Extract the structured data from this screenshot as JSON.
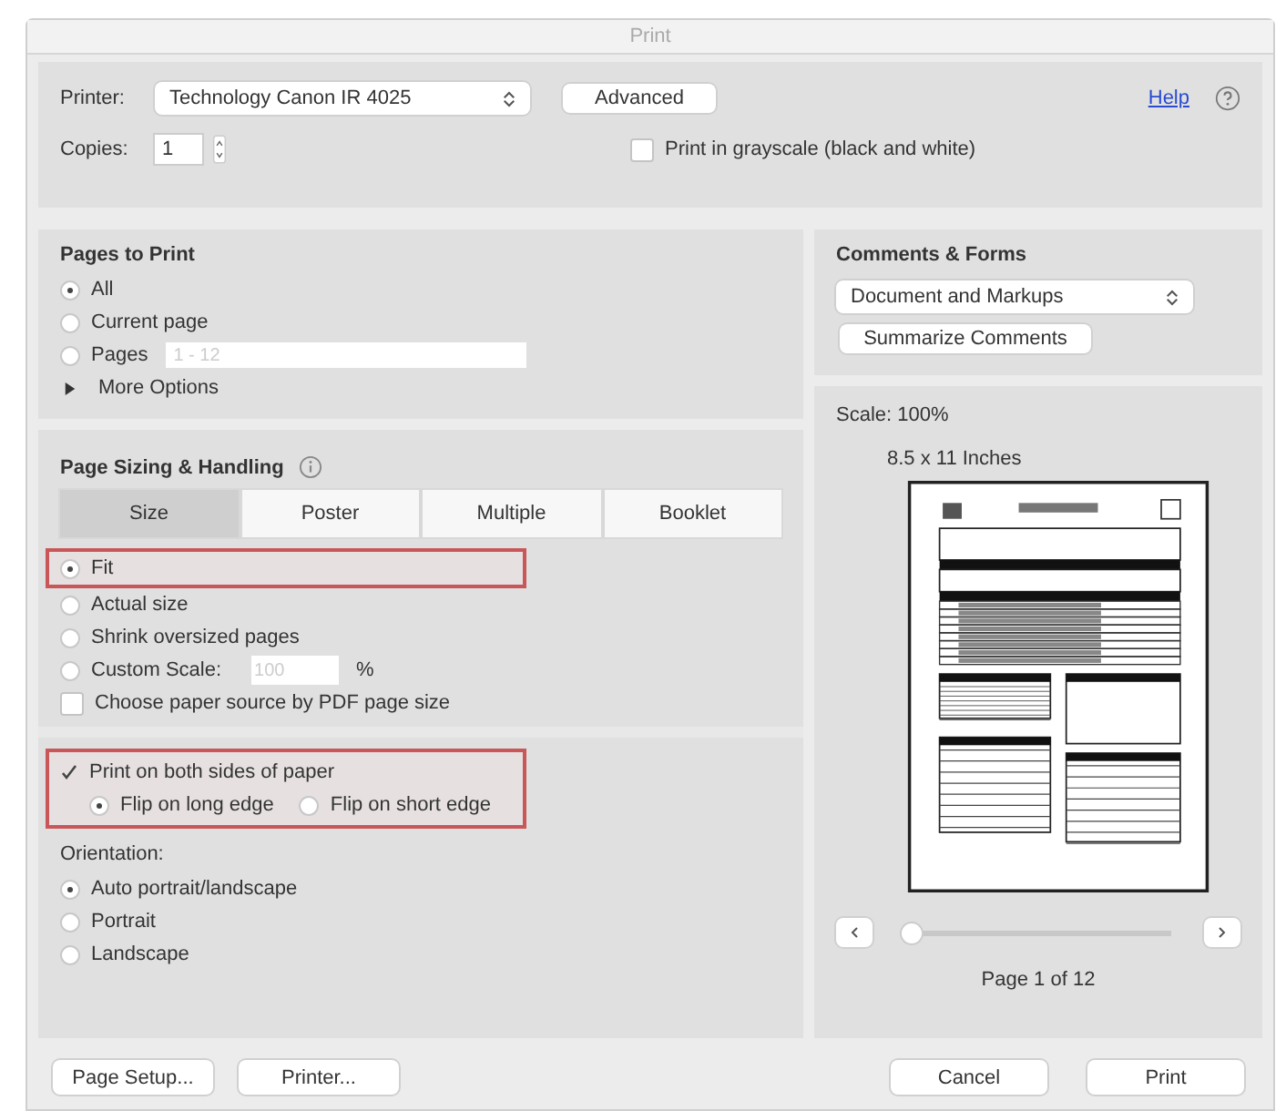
{
  "window": {
    "title": "Print"
  },
  "printer": {
    "label": "Printer:",
    "value": "Technology Canon IR 4025",
    "advanced": "Advanced"
  },
  "help": "Help",
  "copies": {
    "label": "Copies:",
    "value": "1"
  },
  "grayscale": {
    "label": "Print in grayscale (black and white)",
    "checked": false
  },
  "pages_to_print": {
    "title": "Pages to Print",
    "options": [
      {
        "label": "All",
        "selected": true
      },
      {
        "label": "Current page",
        "selected": false
      },
      {
        "label": "Pages",
        "selected": false,
        "placeholder": "1 - 12"
      }
    ],
    "more_options": {
      "label": "More Options",
      "expanded": false
    }
  },
  "page_sizing": {
    "title": "Page Sizing & Handling",
    "tabs": [
      {
        "label": "Size",
        "selected": true
      },
      {
        "label": "Poster",
        "selected": false
      },
      {
        "label": "Multiple",
        "selected": false
      },
      {
        "label": "Booklet",
        "selected": false
      }
    ],
    "options": [
      {
        "label": "Fit",
        "selected": true,
        "highlighted": true
      },
      {
        "label": "Actual size",
        "selected": false,
        "highlighted": false
      },
      {
        "label": "Shrink oversized pages",
        "selected": false,
        "highlighted": false
      },
      {
        "label": "Custom Scale:",
        "selected": false,
        "highlighted": false,
        "placeholder": "100",
        "unit": "%"
      }
    ],
    "paper_source": {
      "label": "Choose paper source by PDF page size",
      "checked": false
    }
  },
  "duplex": {
    "label": "Print on both sides of paper",
    "checked": true,
    "highlighted": true,
    "options": [
      {
        "label": "Flip on long edge",
        "selected": true
      },
      {
        "label": "Flip on short edge",
        "selected": false
      }
    ]
  },
  "orientation": {
    "title": "Orientation:",
    "options": [
      {
        "label": "Auto portrait/landscape",
        "selected": true
      },
      {
        "label": "Portrait",
        "selected": false
      },
      {
        "label": "Landscape",
        "selected": false
      }
    ]
  },
  "comments_forms": {
    "title": "Comments & Forms",
    "value": "Document and Markups",
    "button": "Summarize Comments"
  },
  "preview": {
    "scale": "Scale: 100%",
    "paper": "8.5 x 11 Inches",
    "slider": {
      "level": 0
    },
    "page": "Page 1 of 12"
  },
  "buttons": {
    "page_setup": "Page Setup...",
    "printer": "Printer...",
    "cancel": "Cancel",
    "print": "Print"
  }
}
